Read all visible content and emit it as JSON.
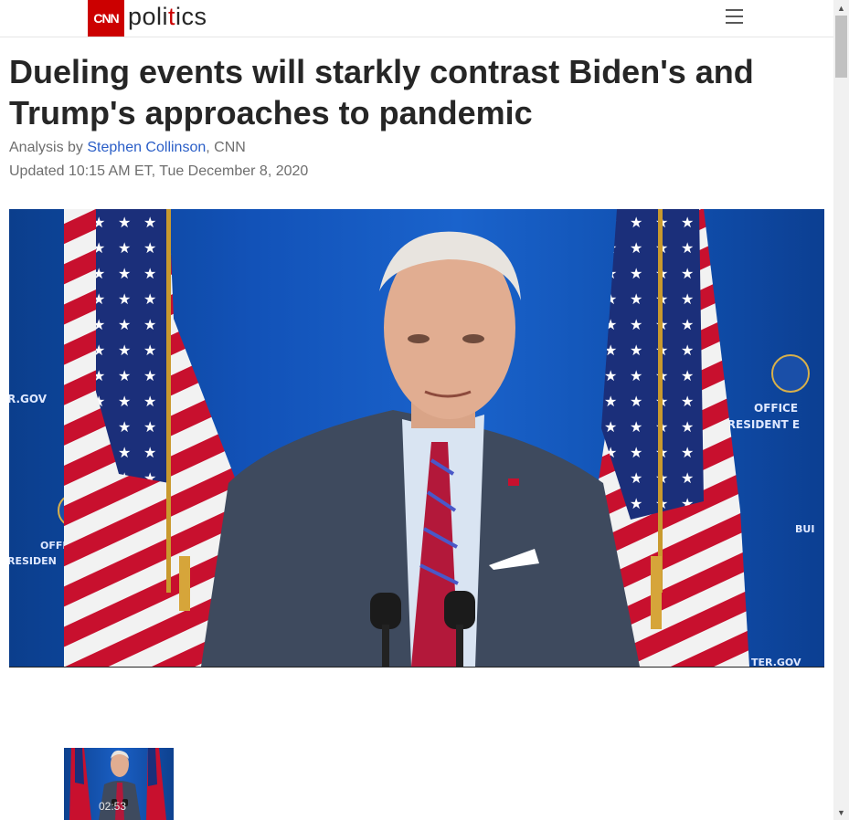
{
  "header": {
    "logo_text": "CNN",
    "section_pre": "poli",
    "section_dot": "t",
    "section_post": "ics",
    "menu_icon": "hamburger-menu-icon"
  },
  "article": {
    "headline": "Dueling events will starkly contrast Biden's and Trump's approaches to pandemic",
    "byline_prefix": "Analysis by ",
    "author": "Stephen Collinson",
    "byline_suffix": ", CNN",
    "updated": "Updated 10:15 AM ET, Tue December 8, 2020"
  },
  "hero": {
    "backdrop_text_left_1": "R.GOV",
    "backdrop_text_left_2": "OFFI",
    "backdrop_text_left_3": "RESIDEN",
    "backdrop_text_right_1": "OFFICE",
    "backdrop_text_right_2": "PRESIDENT E",
    "backdrop_text_right_3": "BUI",
    "backdrop_text_right_4": "TER.GOV"
  },
  "video_thumb": {
    "duration": "02:53"
  },
  "colors": {
    "brand": "#cc0000",
    "link": "#2a5ec7",
    "text": "#262626",
    "meta": "#6e6e6e"
  }
}
